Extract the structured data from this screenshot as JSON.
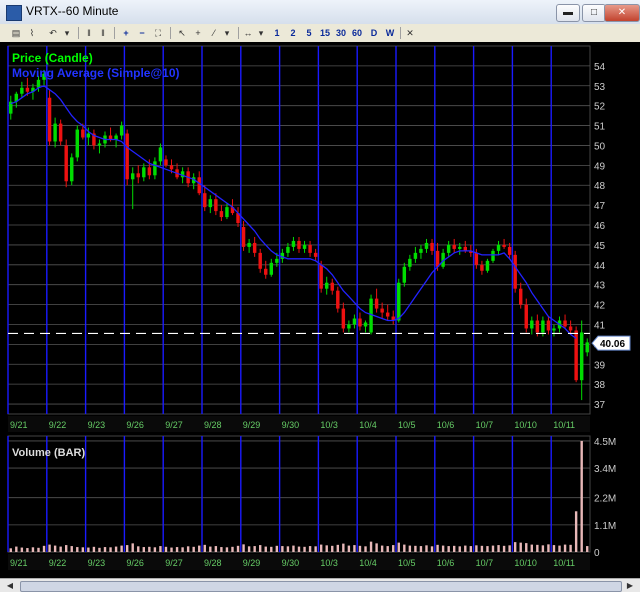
{
  "window": {
    "title": "VRTX--60 Minute",
    "minimize": "▬",
    "maximize": "□",
    "close": "✕"
  },
  "toolbar": {
    "intervals": [
      "1",
      "2",
      "5",
      "15",
      "30",
      "60",
      "D",
      "W"
    ]
  },
  "price_panel": {
    "label1": "Price (Candle)",
    "label2": "Moving Average (Simple@10)",
    "current_price": "40.06",
    "price_line": 40.55
  },
  "volume_panel": {
    "label": "Volume (BAR)"
  },
  "chart_data": [
    {
      "type": "candlestick",
      "title": "VRTX--60 Minute",
      "ylim": [
        36.5,
        55
      ],
      "yticks": [
        37,
        38,
        39,
        40,
        41,
        42,
        43,
        44,
        45,
        46,
        47,
        48,
        49,
        50,
        51,
        52,
        53,
        54
      ],
      "x_dates": [
        {
          "label": "9/21",
          "bar": 0
        },
        {
          "label": "9/22",
          "bar": 7
        },
        {
          "label": "9/23",
          "bar": 14
        },
        {
          "label": "9/26",
          "bar": 21
        },
        {
          "label": "9/27",
          "bar": 28
        },
        {
          "label": "9/28",
          "bar": 35
        },
        {
          "label": "9/29",
          "bar": 42
        },
        {
          "label": "9/30",
          "bar": 49
        },
        {
          "label": "10/3",
          "bar": 56
        },
        {
          "label": "10/4",
          "bar": 63
        },
        {
          "label": "10/5",
          "bar": 70
        },
        {
          "label": "10/6",
          "bar": 77
        },
        {
          "label": "10/7",
          "bar": 84
        },
        {
          "label": "10/10",
          "bar": 91
        },
        {
          "label": "10/11",
          "bar": 98
        }
      ],
      "series": [
        {
          "name": "Price (Candle)",
          "ohlc": [
            [
              51.6,
              52.5,
              51.3,
              52.2
            ],
            [
              52.2,
              52.7,
              51.9,
              52.6
            ],
            [
              52.6,
              53.2,
              52.4,
              52.9
            ],
            [
              52.9,
              53.4,
              52.5,
              52.7
            ],
            [
              52.7,
              53.1,
              52.3,
              52.9
            ],
            [
              52.9,
              53.5,
              52.7,
              53.3
            ],
            [
              53.3,
              53.8,
              53.0,
              53.6
            ],
            [
              52.4,
              52.8,
              50.0,
              50.2
            ],
            [
              50.2,
              51.4,
              49.9,
              51.1
            ],
            [
              51.1,
              51.3,
              50.0,
              50.2
            ],
            [
              50.0,
              50.3,
              47.9,
              48.2
            ],
            [
              48.2,
              49.6,
              48.0,
              49.4
            ],
            [
              49.4,
              51.0,
              49.2,
              50.8
            ],
            [
              50.8,
              51.1,
              50.3,
              50.4
            ],
            [
              50.4,
              50.9,
              50.0,
              50.6
            ],
            [
              50.6,
              50.8,
              49.8,
              50.0
            ],
            [
              50.0,
              50.3,
              49.6,
              50.1
            ],
            [
              50.1,
              50.7,
              49.9,
              50.5
            ],
            [
              50.5,
              50.9,
              50.2,
              50.3
            ],
            [
              50.3,
              50.6,
              49.9,
              50.5
            ],
            [
              50.5,
              51.2,
              50.3,
              51.0
            ],
            [
              50.6,
              50.8,
              48.0,
              48.3
            ],
            [
              48.3,
              48.9,
              46.8,
              48.6
            ],
            [
              48.6,
              49.0,
              48.1,
              48.4
            ],
            [
              48.4,
              49.1,
              48.2,
              48.9
            ],
            [
              48.9,
              49.3,
              48.3,
              48.5
            ],
            [
              48.5,
              49.4,
              48.3,
              49.2
            ],
            [
              49.2,
              50.1,
              49.0,
              49.9
            ],
            [
              49.3,
              49.5,
              48.9,
              49.0
            ],
            [
              49.0,
              49.3,
              48.6,
              48.8
            ],
            [
              48.8,
              49.1,
              48.3,
              48.4
            ],
            [
              48.4,
              48.9,
              48.1,
              48.7
            ],
            [
              48.7,
              48.9,
              47.9,
              48.1
            ],
            [
              48.1,
              48.6,
              47.8,
              48.4
            ],
            [
              48.4,
              48.7,
              47.5,
              47.6
            ],
            [
              47.6,
              48.0,
              46.7,
              46.9
            ],
            [
              46.9,
              47.5,
              46.6,
              47.3
            ],
            [
              47.3,
              47.6,
              46.5,
              46.7
            ],
            [
              46.7,
              47.0,
              46.2,
              46.4
            ],
            [
              46.4,
              47.1,
              46.3,
              46.9
            ],
            [
              46.9,
              47.3,
              46.5,
              46.6
            ],
            [
              46.6,
              46.9,
              45.9,
              46.1
            ],
            [
              45.9,
              46.2,
              44.7,
              44.9
            ],
            [
              44.9,
              45.3,
              44.6,
              45.1
            ],
            [
              45.1,
              45.4,
              44.4,
              44.6
            ],
            [
              44.6,
              44.8,
              43.6,
              43.8
            ],
            [
              43.8,
              44.2,
              43.3,
              43.5
            ],
            [
              43.5,
              44.3,
              43.4,
              44.1
            ],
            [
              44.1,
              44.6,
              43.9,
              44.3
            ],
            [
              44.3,
              44.8,
              44.1,
              44.6
            ],
            [
              44.6,
              45.1,
              44.4,
              44.9
            ],
            [
              44.9,
              45.4,
              44.7,
              45.2
            ],
            [
              45.2,
              45.4,
              44.6,
              44.8
            ],
            [
              44.8,
              45.2,
              44.6,
              45.0
            ],
            [
              45.0,
              45.2,
              44.4,
              44.6
            ],
            [
              44.6,
              44.8,
              44.2,
              44.4
            ],
            [
              44.0,
              44.2,
              42.6,
              42.8
            ],
            [
              42.8,
              43.4,
              42.5,
              43.1
            ],
            [
              43.1,
              43.3,
              42.5,
              42.7
            ],
            [
              42.7,
              42.9,
              41.6,
              41.8
            ],
            [
              41.8,
              42.1,
              40.6,
              40.8
            ],
            [
              40.8,
              41.2,
              40.6,
              41.0
            ],
            [
              41.0,
              41.5,
              40.8,
              41.3
            ],
            [
              41.3,
              41.6,
              40.7,
              40.9
            ],
            [
              40.9,
              41.2,
              40.6,
              41.1
            ],
            [
              40.6,
              42.5,
              40.5,
              42.3
            ],
            [
              42.3,
              42.8,
              41.6,
              41.8
            ],
            [
              41.8,
              42.1,
              41.3,
              41.6
            ],
            [
              41.6,
              42.0,
              41.2,
              41.4
            ],
            [
              41.4,
              41.7,
              41.0,
              41.2
            ],
            [
              41.2,
              43.3,
              41.1,
              43.1
            ],
            [
              43.1,
              44.1,
              42.9,
              43.9
            ],
            [
              43.9,
              44.5,
              43.7,
              44.3
            ],
            [
              44.3,
              44.9,
              44.1,
              44.6
            ],
            [
              44.6,
              45.0,
              44.3,
              44.8
            ],
            [
              44.8,
              45.3,
              44.6,
              45.1
            ],
            [
              45.1,
              45.3,
              44.5,
              44.7
            ],
            [
              44.7,
              45.1,
              43.7,
              43.9
            ],
            [
              43.9,
              44.8,
              43.8,
              44.6
            ],
            [
              44.6,
              45.2,
              44.4,
              45.0
            ],
            [
              45.0,
              45.3,
              44.6,
              44.8
            ],
            [
              44.8,
              45.1,
              44.5,
              44.9
            ],
            [
              44.9,
              45.2,
              44.6,
              44.7
            ],
            [
              44.7,
              45.0,
              44.4,
              44.6
            ],
            [
              44.6,
              44.8,
              43.8,
              44.0
            ],
            [
              44.0,
              44.2,
              43.5,
              43.7
            ],
            [
              43.7,
              44.3,
              43.6,
              44.2
            ],
            [
              44.2,
              44.8,
              44.1,
              44.7
            ],
            [
              44.7,
              45.2,
              44.5,
              45.0
            ],
            [
              45.0,
              45.3,
              44.8,
              44.9
            ],
            [
              44.9,
              45.1,
              44.3,
              44.5
            ],
            [
              44.5,
              44.7,
              42.6,
              42.8
            ],
            [
              42.8,
              43.1,
              41.8,
              42.0
            ],
            [
              42.0,
              42.3,
              40.6,
              40.8
            ],
            [
              40.8,
              41.4,
              40.5,
              41.2
            ],
            [
              41.2,
              41.5,
              40.4,
              40.6
            ],
            [
              40.6,
              41.4,
              40.4,
              41.2
            ],
            [
              41.2,
              41.4,
              40.5,
              40.7
            ],
            [
              40.7,
              41.0,
              40.4,
              40.8
            ],
            [
              40.8,
              41.4,
              40.6,
              41.2
            ],
            [
              41.2,
              41.5,
              40.8,
              40.9
            ],
            [
              40.9,
              41.2,
              40.5,
              40.7
            ],
            [
              40.7,
              40.9,
              38.1,
              38.2
            ],
            [
              38.2,
              41.2,
              37.2,
              40.6
            ],
            [
              39.6,
              40.3,
              39.4,
              40.1
            ]
          ]
        },
        {
          "name": "Moving Average (Simple@10)",
          "values": [
            52.1,
            52.2,
            52.4,
            52.6,
            52.7,
            52.9,
            53.0,
            52.8,
            52.6,
            52.3,
            51.9,
            51.5,
            51.2,
            51.0,
            50.7,
            50.5,
            50.4,
            50.3,
            50.3,
            50.3,
            50.2,
            49.9,
            49.7,
            49.5,
            49.3,
            49.1,
            49.0,
            48.9,
            48.8,
            48.7,
            48.6,
            48.5,
            48.4,
            48.3,
            48.1,
            47.9,
            47.7,
            47.5,
            47.3,
            47.1,
            46.9,
            46.6,
            46.3,
            46.0,
            45.7,
            45.3,
            45.0,
            44.7,
            44.5,
            44.4,
            44.3,
            44.3,
            44.3,
            44.3,
            44.3,
            44.2,
            44.0,
            43.8,
            43.5,
            43.1,
            42.7,
            42.4,
            42.1,
            41.8,
            41.6,
            41.5,
            41.4,
            41.3,
            41.2,
            41.2,
            41.3,
            41.6,
            42.0,
            42.4,
            42.8,
            43.2,
            43.6,
            43.9,
            44.2,
            44.4,
            44.6,
            44.7,
            44.7,
            44.7,
            44.6,
            44.5,
            44.5,
            44.5,
            44.5,
            44.6,
            44.3,
            43.9,
            43.5,
            43.1,
            42.6,
            42.2,
            41.8,
            41.4,
            41.2,
            41.0,
            40.8,
            40.5,
            40.3
          ]
        }
      ]
    },
    {
      "type": "bar",
      "title": "Volume (BAR)",
      "ylim": [
        0,
        4700000
      ],
      "yticks": [
        {
          "label": "0",
          "value": 0
        },
        {
          "label": "1.1M",
          "value": 1100000
        },
        {
          "label": "2.2M",
          "value": 2200000
        },
        {
          "label": "3.4M",
          "value": 3400000
        },
        {
          "label": "4.5M",
          "value": 4500000
        }
      ],
      "values": [
        150000,
        220000,
        180000,
        160000,
        190000,
        170000,
        250000,
        300000,
        260000,
        220000,
        280000,
        240000,
        200000,
        190000,
        180000,
        210000,
        170000,
        200000,
        190000,
        220000,
        260000,
        280000,
        350000,
        230000,
        200000,
        210000,
        190000,
        240000,
        210000,
        180000,
        200000,
        190000,
        230000,
        210000,
        260000,
        290000,
        220000,
        240000,
        200000,
        190000,
        210000,
        250000,
        310000,
        230000,
        240000,
        280000,
        220000,
        210000,
        250000,
        240000,
        230000,
        260000,
        220000,
        210000,
        240000,
        230000,
        300000,
        270000,
        250000,
        290000,
        340000,
        260000,
        280000,
        250000,
        230000,
        420000,
        350000,
        260000,
        240000,
        280000,
        380000,
        300000,
        260000,
        250000,
        240000,
        270000,
        230000,
        290000,
        260000,
        240000,
        250000,
        230000,
        260000,
        240000,
        270000,
        250000,
        240000,
        260000,
        280000,
        250000,
        270000,
        400000,
        380000,
        360000,
        300000,
        290000,
        270000,
        310000,
        280000,
        260000,
        300000,
        290000,
        1650000,
        4500000,
        240000
      ]
    }
  ]
}
